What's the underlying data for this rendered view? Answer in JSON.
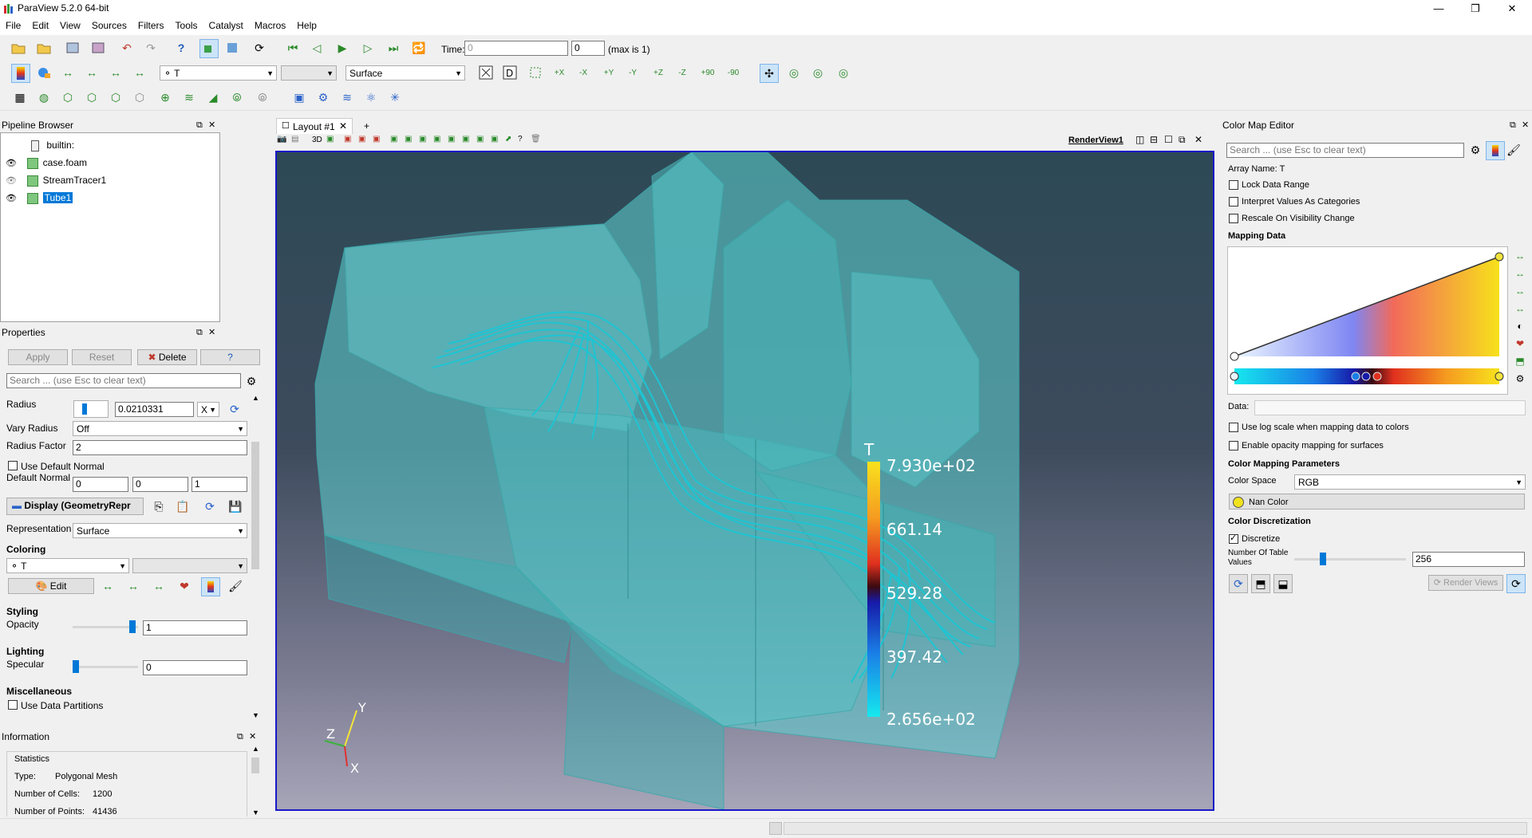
{
  "window": {
    "title": "ParaView 5.2.0 64-bit",
    "controls": [
      "—",
      "❐",
      "✕"
    ]
  },
  "menu": [
    "File",
    "Edit",
    "View",
    "Sources",
    "Filters",
    "Tools",
    "Catalyst",
    "Macros",
    "Help"
  ],
  "time": {
    "label": "Time:",
    "value": "0",
    "step": "0",
    "max_text": "(max is 1)"
  },
  "color_toolbar": {
    "array_combo": "T",
    "representation": "Surface"
  },
  "camera_labels": [
    "+X",
    "-X",
    "+Y",
    "-Y",
    "+Z",
    "-Z",
    "+90",
    "-90"
  ],
  "pipeline": {
    "title": "Pipeline Browser",
    "items": [
      {
        "label": "builtin:"
      },
      {
        "label": "case.foam"
      },
      {
        "label": "StreamTracer1"
      },
      {
        "label": "Tube1"
      }
    ]
  },
  "layout_tab": {
    "label": "Layout #1",
    "close": "✕",
    "add": "+",
    "view_name": "RenderView1",
    "mode_3d": "3D"
  },
  "properties": {
    "title": "Properties",
    "apply": "Apply",
    "reset": "Reset",
    "delete": "Delete",
    "help": "?",
    "search_placeholder": "Search ... (use Esc to clear text)",
    "radius_label": "Radius",
    "radius_value": "0.0210331",
    "radius_axis": "X",
    "vary_radius_label": "Vary Radius",
    "vary_radius_value": "Off",
    "radius_factor_label": "Radius Factor",
    "radius_factor_value": "2",
    "use_default_normal": "Use Default Normal",
    "default_normal_label": "Default Normal",
    "default_normal": [
      "0",
      "0",
      "1"
    ],
    "display_button": "Display (GeometryRepr",
    "representation_label": "Representation",
    "representation_value": "Surface",
    "coloring_title": "Coloring",
    "coloring_array": "T",
    "edit_button": "Edit",
    "styling_title": "Styling",
    "opacity_label": "Opacity",
    "opacity_value": "1",
    "lighting_title": "Lighting",
    "specular_label": "Specular",
    "specular_value": "0",
    "misc_title": "Miscellaneous",
    "use_data_partitions": "Use Data Partitions"
  },
  "information": {
    "title": "Information",
    "statistics": "Statistics",
    "type_label": "Type:",
    "type_value": "Polygonal Mesh",
    "cells_label": "Number of Cells:",
    "cells_value": "1200",
    "points_label": "Number of Points:",
    "points_value": "41436"
  },
  "colorbar": {
    "title": "T",
    "ticks": [
      "7.930e+02",
      "661.14",
      "529.28",
      "397.42",
      "2.656e+02"
    ]
  },
  "axes": {
    "y": "Y",
    "z": "Z",
    "x": "X"
  },
  "cme": {
    "title": "Color Map Editor",
    "search_placeholder": "Search ... (use Esc to clear text)",
    "array_name": "Array Name: T",
    "lock_range": "Lock Data Range",
    "interpret_categories": "Interpret Values As Categories",
    "rescale_visibility": "Rescale On Visibility Change",
    "mapping_data": "Mapping Data",
    "data_label": "Data:",
    "log_scale": "Use log scale when mapping data to colors",
    "opacity_mapping": "Enable opacity mapping for surfaces",
    "params_title": "Color Mapping Parameters",
    "color_space_label": "Color Space",
    "color_space_value": "RGB",
    "nan_color": "Nan Color",
    "discretization_title": "Color Discretization",
    "discretize": "Discretize",
    "table_values_label": "Number Of Table Values",
    "table_values": "256",
    "render_views": "Render Views"
  },
  "colors": {
    "accent": "#0078d7",
    "surface": "#5fd2d4",
    "selection": "#0078d7"
  }
}
